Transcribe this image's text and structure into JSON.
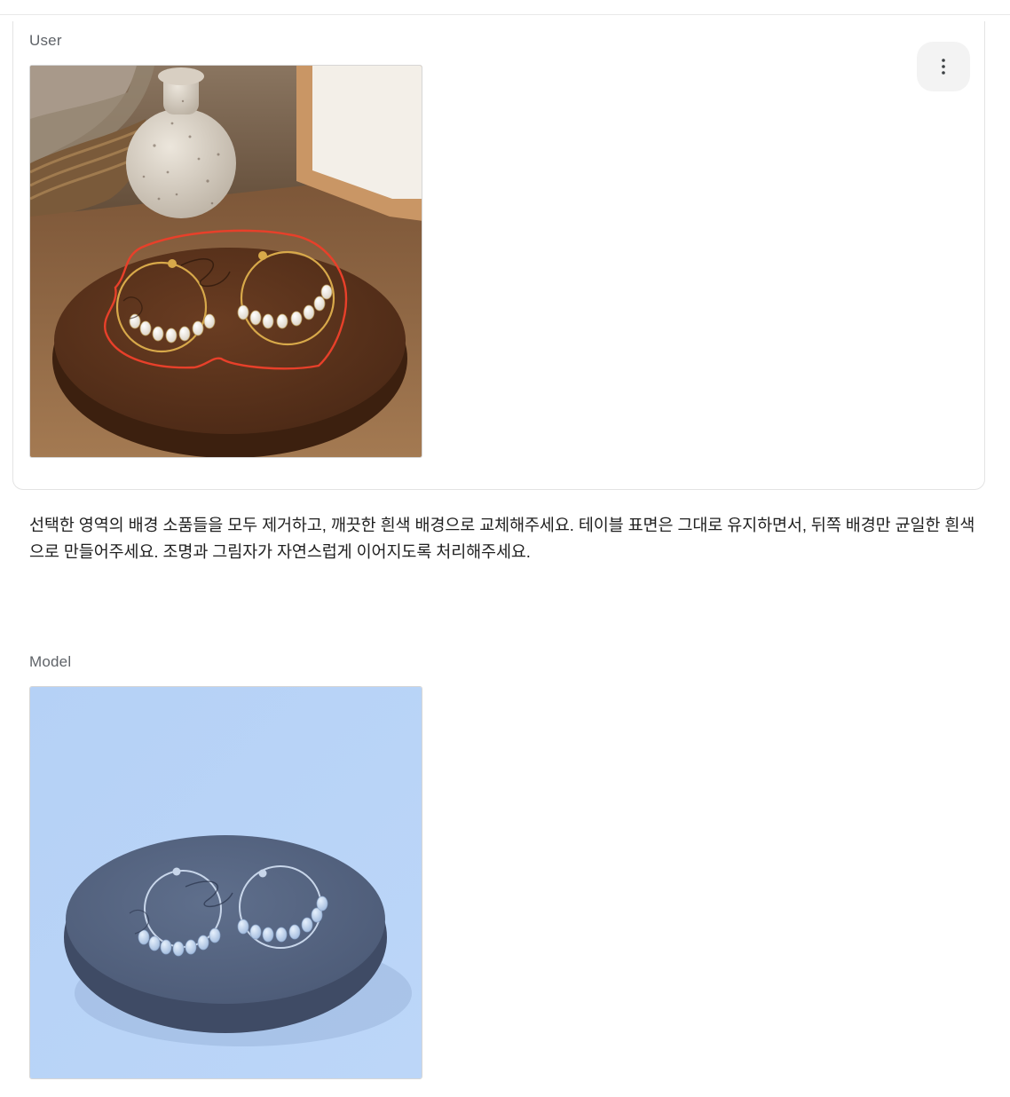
{
  "conversation": {
    "user": {
      "role_label": "User",
      "prompt": "선택한 영역의 배경 소품들을 모두 제거하고, 깨끗한 흰색 배경으로 교체해주세요. 테이블 표면은 그대로 유지하면서, 뒤쪽 배경만 균일한 흰색으로 만들어주세요. 조명과 그림자가 자연스럽게 이어지도록 처리해주세요."
    },
    "model": {
      "role_label": "Model"
    }
  },
  "icons": {
    "more": "more-vert-icon"
  },
  "colors": {
    "selection_stroke": "#e8402a",
    "model_tint": "#b8d3f7",
    "wood": "#5a3320"
  }
}
